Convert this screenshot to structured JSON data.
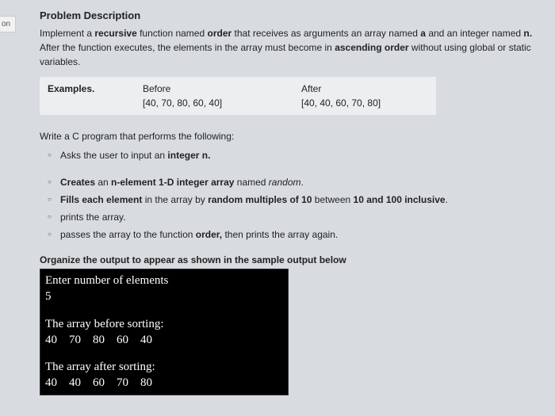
{
  "sidetag": "on",
  "heading": "Problem Description",
  "intro_parts": {
    "p1a": "Implement a ",
    "p1b": "recursive",
    "p1c": " function named ",
    "p1d": "order",
    "p1e": " that receives as arguments an array named ",
    "p1f": "a",
    "p1g": " and an integer named ",
    "p1h": "n.",
    "p1i": " After the function executes, the elements in the array must become in ",
    "p1j": "ascending order",
    "p1k": " without using global or static variables."
  },
  "example": {
    "label": "Examples.",
    "before_label": "Before",
    "after_label": "After",
    "before_val": "[40, 70, 80, 60, 40]",
    "after_val": "[40, 40, 60, 70, 80]"
  },
  "task_intro": "Write a C program that performs the following:",
  "bullets1": {
    "b1a": "Asks the user to input an ",
    "b1b": "integer n."
  },
  "bullets2": {
    "b2a1": "Creates",
    "b2a2": " an ",
    "b2a3": "n-element 1-D integer array",
    "b2a4": " named ",
    "b2a5": "random",
    "b2a6": ".",
    "b2b1": "Fills each element",
    "b2b2": " in the array by ",
    "b2b3": "random multiples of 10",
    "b2b4": " between ",
    "b2b5": "10 and 100 inclusive",
    "b2b6": ".",
    "b2c": "prints the array.",
    "b2d1": "passes the array to the function ",
    "b2d2": "order,",
    "b2d3": " then prints the array again."
  },
  "organize": "Organize the output to appear as shown in the sample output below",
  "terminal": {
    "l1": "Enter number of elements",
    "l2": "5",
    "l3": "The array before sorting:",
    "l4": "40    70    80    60    40",
    "l5": "The array after sorting:",
    "l6": "40    40    60    70    80"
  }
}
